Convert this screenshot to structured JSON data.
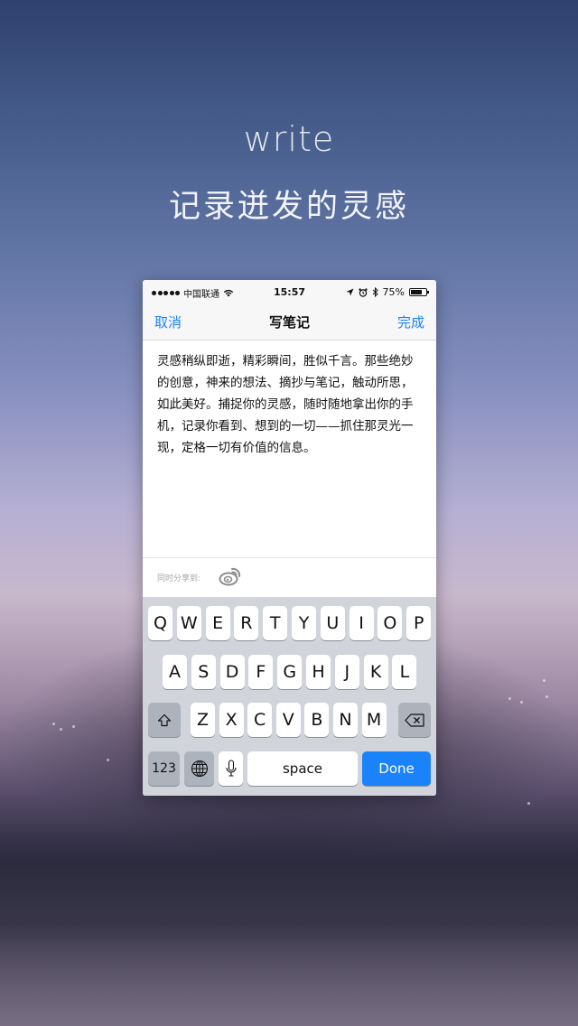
{
  "hero": {
    "title": "write",
    "subtitle": "记录迸发的灵感"
  },
  "status_bar": {
    "carrier": "中国联通",
    "time": "15:57",
    "battery": "75%",
    "battery_level": 0.75
  },
  "nav": {
    "cancel_label": "取消",
    "title": "写笔记",
    "done_label": "完成"
  },
  "note": {
    "text": "灵感稍纵即逝，精彩瞬间，胜似千言。那些绝妙的创意，神来的想法、摘抄与笔记，触动所思，如此美好。捕捉你的灵感，随时随地拿出你的手机，记录你看到、想到的一切——抓住那灵光一现，定格一切有价值的信息。"
  },
  "share": {
    "label": "同时分享到:",
    "targets": [
      "weibo-icon"
    ]
  },
  "keyboard": {
    "row1": [
      "Q",
      "W",
      "E",
      "R",
      "T",
      "Y",
      "U",
      "I",
      "O",
      "P"
    ],
    "row2": [
      "A",
      "S",
      "D",
      "F",
      "G",
      "H",
      "J",
      "K",
      "L"
    ],
    "row3": [
      "Z",
      "X",
      "C",
      "V",
      "B",
      "N",
      "M"
    ],
    "numbers_label": "123",
    "space_label": "space",
    "done_label": "Done"
  },
  "colors": {
    "accent": "#1a82fb",
    "keyboard_bg": "#d1d5db",
    "function_key": "#acb3bc"
  }
}
